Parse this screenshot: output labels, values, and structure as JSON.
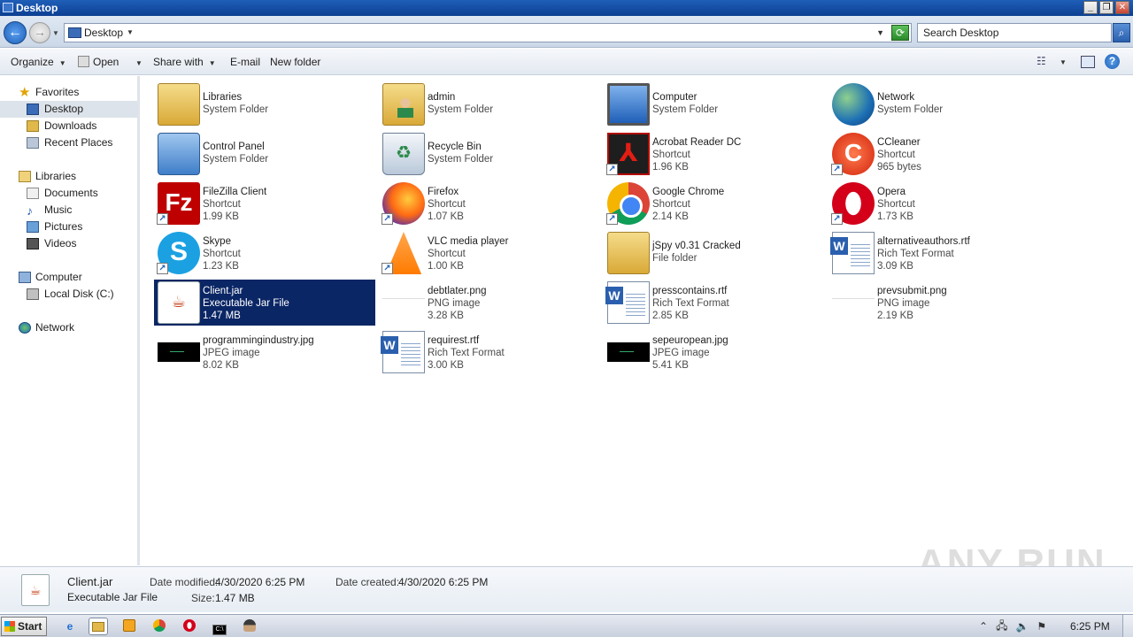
{
  "window": {
    "title": "Desktop"
  },
  "address": {
    "crumb": "Desktop",
    "search_placeholder": "Search Desktop"
  },
  "toolbar": {
    "organize": "Organize",
    "open": "Open",
    "share_with": "Share with",
    "email": "E-mail",
    "new_folder": "New folder"
  },
  "nav": {
    "favorites": "Favorites",
    "desktop": "Desktop",
    "downloads": "Downloads",
    "recent": "Recent Places",
    "libraries": "Libraries",
    "documents": "Documents",
    "music": "Music",
    "pictures": "Pictures",
    "videos": "Videos",
    "computer": "Computer",
    "local_disk": "Local Disk (C:)",
    "network": "Network"
  },
  "files": [
    {
      "name": "Libraries",
      "type": "System Folder",
      "size": "",
      "icon": "libraries-icon"
    },
    {
      "name": "admin",
      "type": "System Folder",
      "size": "",
      "icon": "user-folder-icon"
    },
    {
      "name": "Computer",
      "type": "System Folder",
      "size": "",
      "icon": "computer-icon"
    },
    {
      "name": "Network",
      "type": "System Folder",
      "size": "",
      "icon": "network-icon"
    },
    {
      "name": "Control Panel",
      "type": "System Folder",
      "size": "",
      "icon": "control-panel-icon"
    },
    {
      "name": "Recycle Bin",
      "type": "System Folder",
      "size": "",
      "icon": "recycle-bin-icon"
    },
    {
      "name": "Acrobat Reader DC",
      "type": "Shortcut",
      "size": "1.96 KB",
      "icon": "acrobat-icon"
    },
    {
      "name": "CCleaner",
      "type": "Shortcut",
      "size": "965 bytes",
      "icon": "ccleaner-icon"
    },
    {
      "name": "FileZilla Client",
      "type": "Shortcut",
      "size": "1.99 KB",
      "icon": "filezilla-icon"
    },
    {
      "name": "Firefox",
      "type": "Shortcut",
      "size": "1.07 KB",
      "icon": "firefox-icon"
    },
    {
      "name": "Google Chrome",
      "type": "Shortcut",
      "size": "2.14 KB",
      "icon": "chrome-icon"
    },
    {
      "name": "Opera",
      "type": "Shortcut",
      "size": "1.73 KB",
      "icon": "opera-icon"
    },
    {
      "name": "Skype",
      "type": "Shortcut",
      "size": "1.23 KB",
      "icon": "skype-icon"
    },
    {
      "name": "VLC media player",
      "type": "Shortcut",
      "size": "1.00 KB",
      "icon": "vlc-icon"
    },
    {
      "name": "jSpy v0.31 Cracked",
      "type": "File folder",
      "size": "",
      "icon": "folder-icon"
    },
    {
      "name": "alternativeauthors.rtf",
      "type": "Rich Text Format",
      "size": "3.09 KB",
      "icon": "word-document-icon"
    },
    {
      "name": "Client.jar",
      "type": "Executable Jar File",
      "size": "1.47 MB",
      "icon": "java-icon"
    },
    {
      "name": "debtlater.png",
      "type": "PNG image",
      "size": "3.28 KB",
      "icon": "png-thumbnail-icon"
    },
    {
      "name": "presscontains.rtf",
      "type": "Rich Text Format",
      "size": "2.85 KB",
      "icon": "word-document-icon"
    },
    {
      "name": "prevsubmit.png",
      "type": "PNG image",
      "size": "2.19 KB",
      "icon": "png-thumbnail-icon"
    },
    {
      "name": "programmingindustry.jpg",
      "type": "JPEG image",
      "size": "8.02 KB",
      "icon": "jpg-thumbnail-icon"
    },
    {
      "name": "requirest.rtf",
      "type": "Rich Text Format",
      "size": "3.00 KB",
      "icon": "word-document-icon"
    },
    {
      "name": "sepeuropean.jpg",
      "type": "JPEG image",
      "size": "5.41 KB",
      "icon": "jpg-thumbnail-icon"
    }
  ],
  "details": {
    "name": "Client.jar",
    "type": "Executable Jar File",
    "modified_label": "Date modified:",
    "modified": "4/30/2020 6:25 PM",
    "created_label": "Date created:",
    "created": "4/30/2020 6:25 PM",
    "size_label": "Size:",
    "size": "1.47 MB"
  },
  "watermark": "ANY RUN",
  "taskbar": {
    "start": "Start",
    "clock": "6:25 PM"
  }
}
